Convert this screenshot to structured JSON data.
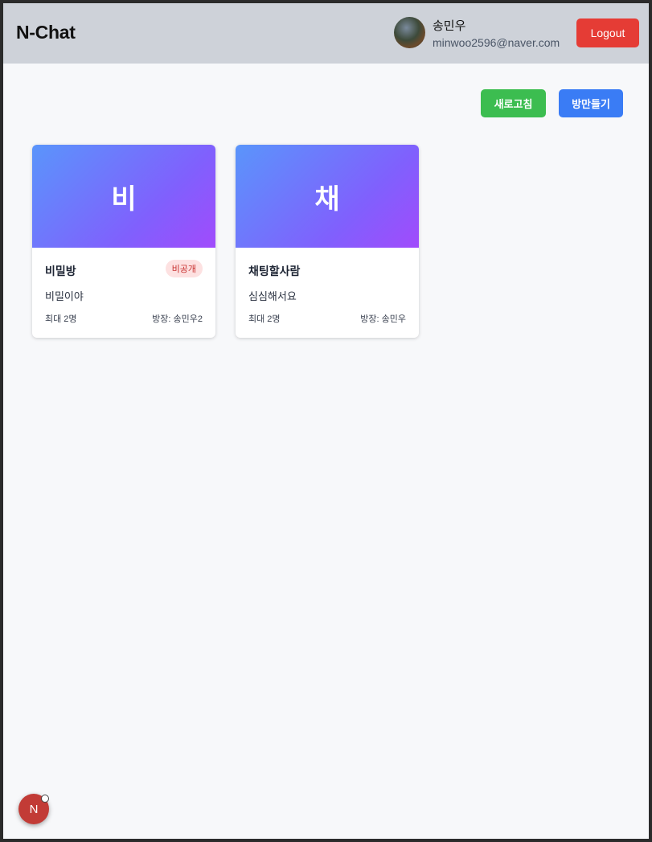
{
  "header": {
    "brand": "N-Chat",
    "user": {
      "name": "송민우",
      "email": "minwoo2596@naver.com"
    },
    "logout_label": "Logout"
  },
  "toolbar": {
    "refresh_label": "새로고침",
    "create_room_label": "방만들기"
  },
  "rooms": [
    {
      "initial": "비",
      "title": "비밀방",
      "badge": "비공개",
      "description": "비밀이야",
      "max_members": "최대 2명",
      "owner": "방장: 송민우2"
    },
    {
      "initial": "채",
      "title": "채팅할사람",
      "description": "심심해서요",
      "max_members": "최대 2명",
      "owner": "방장: 송민우"
    }
  ],
  "floating_badge": {
    "letter": "N"
  },
  "colors": {
    "header_bg": "#ced2d9",
    "logout": "#e53c35",
    "refresh": "#3cbd50",
    "create": "#3a7cf5",
    "banner_gradient": [
      "#5a95fb",
      "#a14bfc"
    ],
    "private_badge_bg": "#fde1e1",
    "private_badge_text": "#c8302f"
  }
}
